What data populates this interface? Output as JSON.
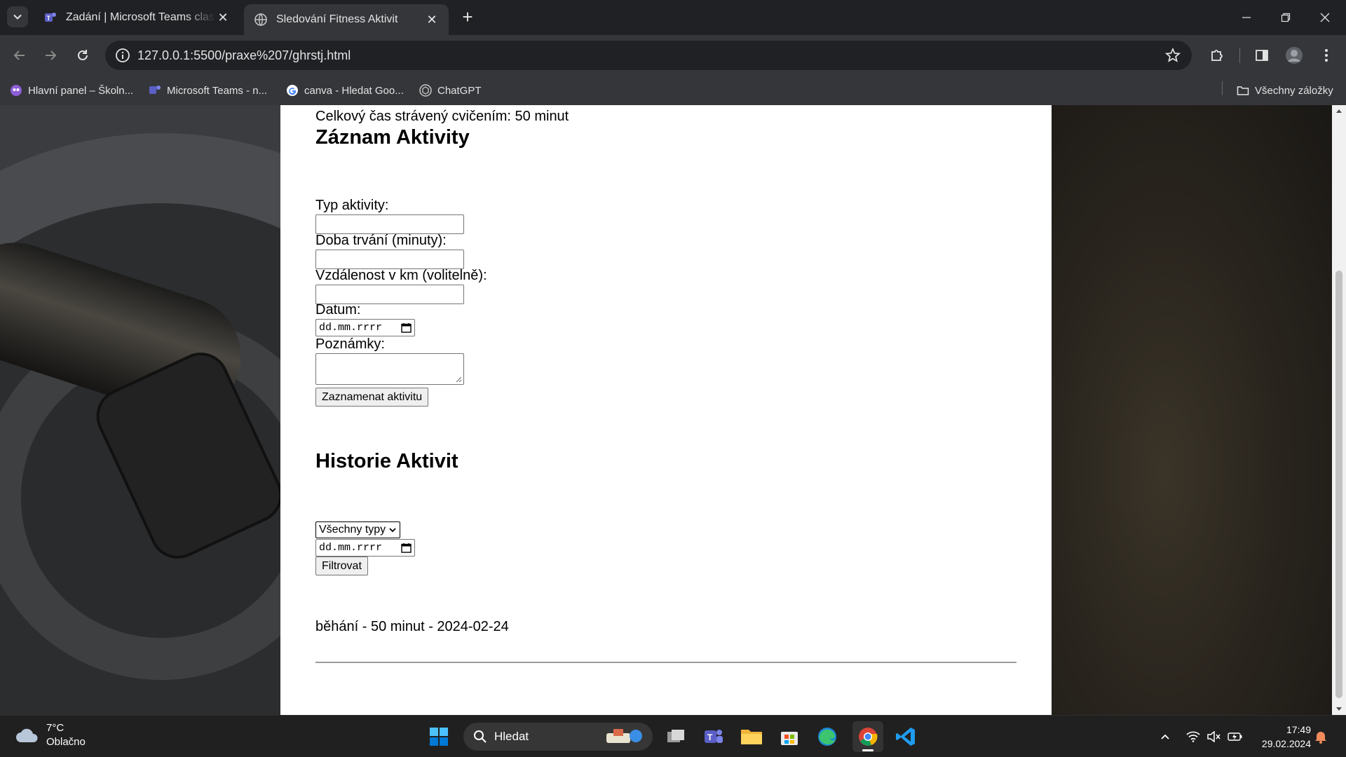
{
  "browser": {
    "tabs": [
      {
        "title": "Zadání | Microsoft Teams classic",
        "active": false
      },
      {
        "title": "Sledování Fitness Aktivit",
        "active": true
      }
    ],
    "new_tab_symbol": "+",
    "close_symbol": "✕",
    "url": "127.0.0.1:5500/praxe%207/ghrstj.html",
    "bookmarks": [
      {
        "label": "Hlavní panel – Školn...",
        "icon": "school-icon"
      },
      {
        "label": "Microsoft Teams - n...",
        "icon": "teams-icon"
      },
      {
        "label": "canva - Hledat Goo...",
        "icon": "google-icon"
      },
      {
        "label": "ChatGPT",
        "icon": "chatgpt-icon"
      }
    ],
    "all_bookmarks_label": "Všechny záložky"
  },
  "page": {
    "total_time": "Celkový čas strávený cvičením: 50 minut",
    "record_heading": "Záznam Aktivity",
    "labels": {
      "type": "Typ aktivity:",
      "duration": "Doba trvání (minuty):",
      "distance": "Vzdálenost v km (volitelně):",
      "date": "Datum:",
      "notes": "Poznámky:"
    },
    "date_placeholder": "dd.mm.rrrr",
    "submit_label": "Zaznamenat aktivitu",
    "history_heading": "Historie Aktivit",
    "filter_select_value": "Všechny typy",
    "filter_date_placeholder": "dd.mm.rrrr",
    "filter_button": "Filtrovat",
    "history_entries": [
      {
        "text": "běhání - 50 minut - 2024-02-24"
      }
    ]
  },
  "taskbar": {
    "weather": {
      "temp": "7°C",
      "condition": "Oblačno"
    },
    "search_placeholder": "Hledat",
    "time": "17:49",
    "date": "29.02.2024"
  },
  "colors": {
    "chrome_dark": "#202124",
    "chrome_toolbar": "#35363a",
    "page_bg": "#ffffff",
    "taskbar": "#202020"
  }
}
